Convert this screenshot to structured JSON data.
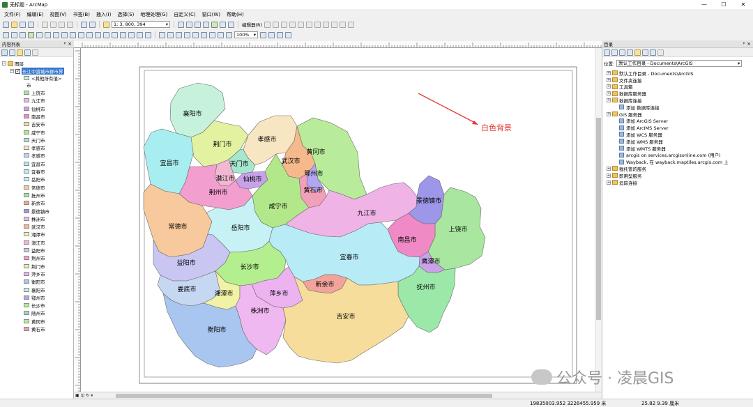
{
  "window": {
    "title": "无标题 - ArcMap"
  },
  "menu": [
    "文件(F)",
    "编辑(E)",
    "视图(V)",
    "书签(B)",
    "插入(I)",
    "选择(S)",
    "地理处理(G)",
    "自定义(C)",
    "窗口(W)",
    "帮助(H)"
  ],
  "toolbar": {
    "scale": "1: 3, 800, 394",
    "editor": "编辑器(R)",
    "zoom": "100%"
  },
  "toc": {
    "title": "内容列表",
    "layers_group": "图层",
    "layer_name": "长江中游城市群市界",
    "other_values": "<其他所有值>",
    "field": "市",
    "cities": [
      {
        "name": "上饶市",
        "color": "#a9e6a0"
      },
      {
        "name": "九江市",
        "color": "#f0b3e6"
      },
      {
        "name": "仙桃市",
        "color": "#c7a2ea"
      },
      {
        "name": "南昌市",
        "color": "#f08ac6"
      },
      {
        "name": "吉安市",
        "color": "#f6dd9c"
      },
      {
        "name": "咸宁市",
        "color": "#b3e88a"
      },
      {
        "name": "天门市",
        "color": "#a6e6cf"
      },
      {
        "name": "孝感市",
        "color": "#f8e6c2"
      },
      {
        "name": "孝感市",
        "color": "#b8d7f2"
      },
      {
        "name": "宜昌市",
        "color": "#a8eef0"
      },
      {
        "name": "宜春市",
        "color": "#b7ebf5"
      },
      {
        "name": "岳阳市",
        "color": "#c7f2f5"
      },
      {
        "name": "常德市",
        "color": "#f7c99c"
      },
      {
        "name": "抚州市",
        "color": "#9be8a8"
      },
      {
        "name": "新余市",
        "color": "#f2a39b"
      },
      {
        "name": "景德镇市",
        "color": "#9e96e8"
      },
      {
        "name": "株洲市",
        "color": "#f0b8f0"
      },
      {
        "name": "武汉市",
        "color": "#f5b98b"
      },
      {
        "name": "湘潭市",
        "color": "#f2f2a6"
      },
      {
        "name": "潜江市",
        "color": "#f2b8d2"
      },
      {
        "name": "益阳市",
        "color": "#c9c6f2"
      },
      {
        "name": "荆州市",
        "color": "#f29ecf"
      },
      {
        "name": "荆门市",
        "color": "#e3f2a0"
      },
      {
        "name": "萍乡市",
        "color": "#ecb3f0"
      },
      {
        "name": "衡阳市",
        "color": "#a9c6f0"
      },
      {
        "name": "襄阳市",
        "color": "#c6f2dc"
      },
      {
        "name": "鄂州市",
        "color": "#b3a6f0"
      },
      {
        "name": "长沙市",
        "color": "#b3ee8f"
      },
      {
        "name": "随州市",
        "color": "#9bd6c9"
      },
      {
        "name": "黄冈市",
        "color": "#b8ec9a"
      },
      {
        "name": "黄石市",
        "color": "#f0a0b8"
      }
    ]
  },
  "map": {
    "annotation": "白色背景",
    "regions": [
      {
        "name": "襄阳市",
        "color": "#c6f2dc"
      },
      {
        "name": "宜昌市",
        "color": "#a8eef0"
      },
      {
        "name": "荆门市",
        "color": "#e3f2a0"
      },
      {
        "name": "孝感市",
        "color": "#f8e6c2"
      },
      {
        "name": "黄冈市",
        "color": "#b8ec9a"
      },
      {
        "name": "天门市",
        "color": "#a6e6cf"
      },
      {
        "name": "武汉市",
        "color": "#f5b98b"
      },
      {
        "name": "鄂州市",
        "color": "#b3a6f0"
      },
      {
        "name": "潜江市",
        "color": "#f2b8d2"
      },
      {
        "name": "仙桃市",
        "color": "#c7a2ea"
      },
      {
        "name": "荆州市",
        "color": "#f29ecf"
      },
      {
        "name": "黄石市",
        "color": "#f0a0b8"
      },
      {
        "name": "咸宁市",
        "color": "#b3e88a"
      },
      {
        "name": "九江市",
        "color": "#f0b3e6"
      },
      {
        "name": "景德镇市",
        "color": "#9e96e8"
      },
      {
        "name": "上饶市",
        "color": "#a9e6a0"
      },
      {
        "name": "常德市",
        "color": "#f7c99c"
      },
      {
        "name": "岳阳市",
        "color": "#c7f2f5"
      },
      {
        "name": "南昌市",
        "color": "#f08ac6"
      },
      {
        "name": "鹰潭市",
        "color": "#c9a2ea"
      },
      {
        "name": "益阳市",
        "color": "#c9c6f2"
      },
      {
        "name": "长沙市",
        "color": "#b3ee8f"
      },
      {
        "name": "宜春市",
        "color": "#b7ebf5"
      },
      {
        "name": "新余市",
        "color": "#f2a39b"
      },
      {
        "name": "抚州市",
        "color": "#9be8a8"
      },
      {
        "name": "娄底市",
        "color": "#c6d7f2"
      },
      {
        "name": "湘潭市",
        "color": "#f2f2a6"
      },
      {
        "name": "萍乡市",
        "color": "#ecb3f0"
      },
      {
        "name": "株洲市",
        "color": "#f0b8f0"
      },
      {
        "name": "吉安市",
        "color": "#f6dd9c"
      },
      {
        "name": "衡阳市",
        "color": "#a9c6f0"
      }
    ]
  },
  "catalog": {
    "title": "目录",
    "location_label": "位置:",
    "location_value": "默认工作目录 - Documents\\ArcGIS",
    "items": [
      {
        "label": "默认工作目录 - Documents\\ArcGIS",
        "level": 0
      },
      {
        "label": "文件夹连接",
        "level": 0
      },
      {
        "label": "工具箱",
        "level": 0
      },
      {
        "label": "数据库服务器",
        "level": 0
      },
      {
        "label": "数据库连接",
        "level": 0
      },
      {
        "label": "添加 数据库连接",
        "level": 1
      },
      {
        "label": "GIS 服务器",
        "level": 0
      },
      {
        "label": "添加 ArcGIS Server",
        "level": 1
      },
      {
        "label": "添加 ArcIMS Server",
        "level": 1
      },
      {
        "label": "添加 WCS 服务器",
        "level": 1
      },
      {
        "label": "添加 WMS 服务器",
        "level": 1
      },
      {
        "label": "添加 WMTS 服务器",
        "level": 1
      },
      {
        "label": "arcgis on services.arcgisonline.com (用户)",
        "level": 1
      },
      {
        "label": "Wayback, 在 wayback.maptiles.arcgis.com 上",
        "level": 1
      },
      {
        "label": "我托管的服务",
        "level": 0
      },
      {
        "label": "即用型服务",
        "level": 0
      },
      {
        "label": "追踪连接",
        "level": 0
      }
    ]
  },
  "status": {
    "coords": "19835003.952  3226455.959 米",
    "page": "25.82  9.39 厘米"
  },
  "watermark": "公众号 · 凌晨GIS"
}
